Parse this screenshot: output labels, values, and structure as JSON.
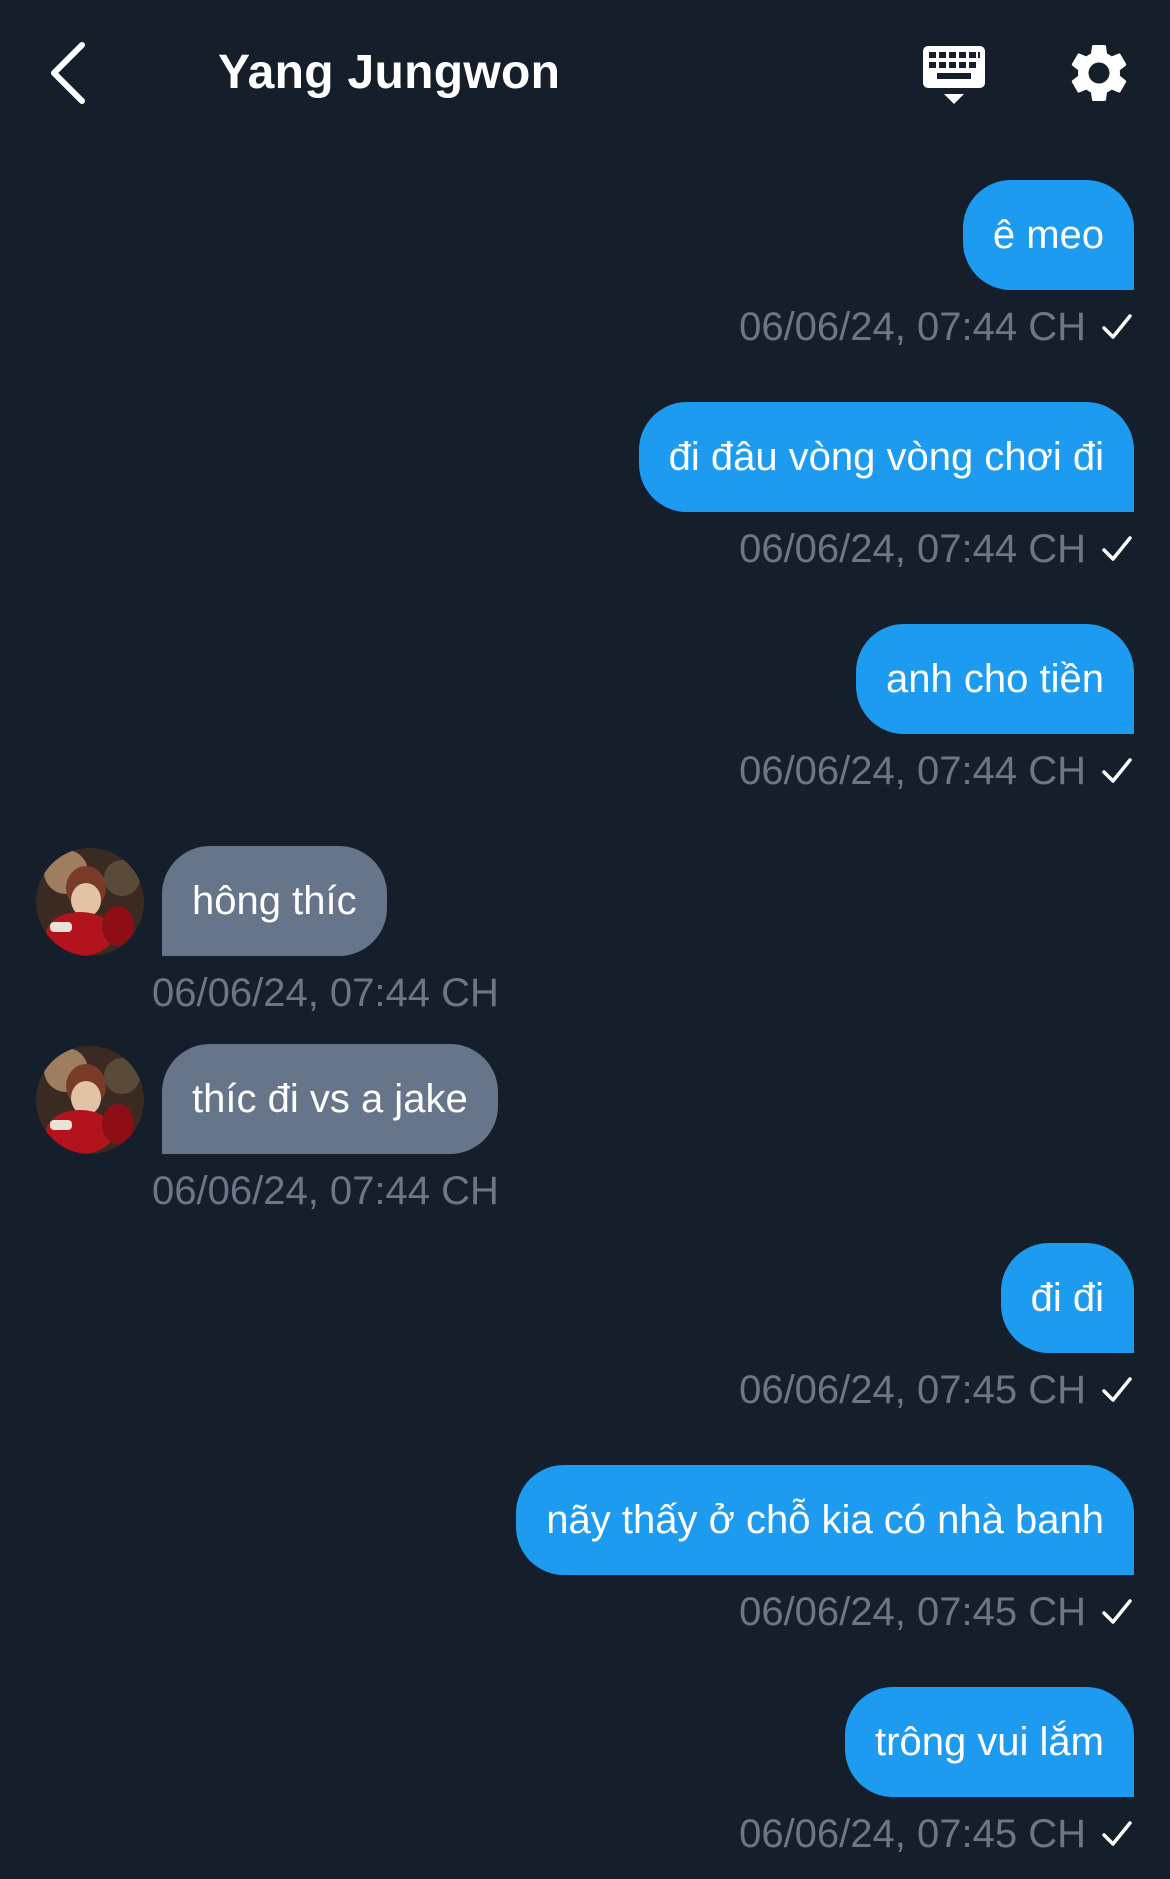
{
  "header": {
    "title": "Yang Jungwon"
  },
  "colors": {
    "background": "#151e2b",
    "outgoing_bubble": "#1d9bf0",
    "incoming_bubble": "#66758a",
    "timestamp": "#6b7686"
  },
  "messages": [
    {
      "direction": "outgoing",
      "text": "ê meo",
      "time": "06/06/24, 07:44 CH",
      "read_icon": "check-icon"
    },
    {
      "direction": "outgoing",
      "text": "đi đâu vòng vòng chơi đi",
      "time": "06/06/24, 07:44 CH",
      "read_icon": "check-icon"
    },
    {
      "direction": "outgoing",
      "text": "anh cho tiền",
      "time": "06/06/24, 07:44 CH",
      "read_icon": "check-icon"
    },
    {
      "direction": "incoming",
      "text": "hông thíc",
      "time": "06/06/24, 07:44 CH"
    },
    {
      "direction": "incoming",
      "text": "thíc đi vs a jake",
      "time": "06/06/24, 07:44 CH"
    },
    {
      "direction": "outgoing",
      "text": "đi đi",
      "time": "06/06/24, 07:45 CH",
      "read_icon": "check-icon"
    },
    {
      "direction": "outgoing",
      "text": "nãy thấy ở chỗ kia có nhà banh",
      "time": "06/06/24, 07:45 CH",
      "read_icon": "check-icon"
    },
    {
      "direction": "outgoing",
      "text": "trông vui lắm",
      "time": "06/06/24, 07:45 CH",
      "read_icon": "check-icon"
    }
  ]
}
